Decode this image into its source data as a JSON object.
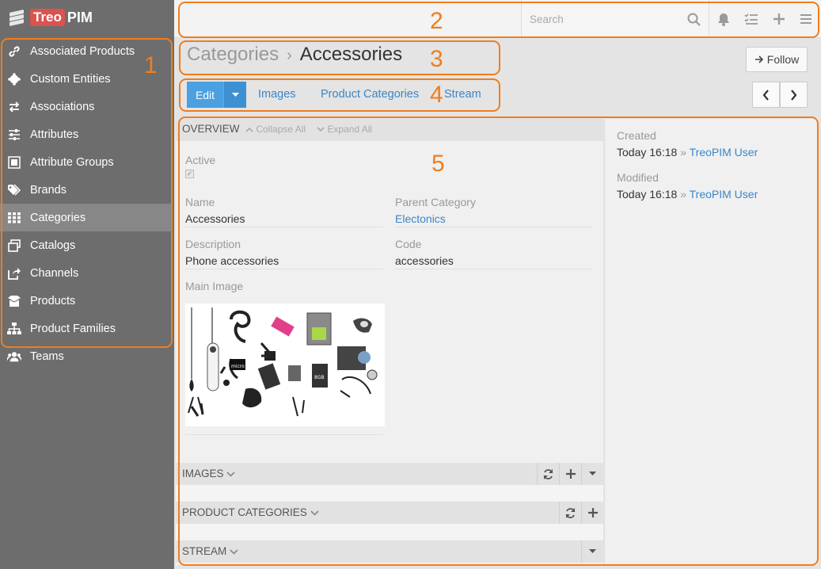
{
  "logo": {
    "part1": "Treo",
    "part2": "PIM"
  },
  "sidebar": {
    "items": [
      {
        "label": "Associated Products",
        "icon": "link-icon"
      },
      {
        "label": "Custom Entities",
        "icon": "puzzle-icon"
      },
      {
        "label": "Associations",
        "icon": "arrows-icon"
      },
      {
        "label": "Attributes",
        "icon": "sliders-icon"
      },
      {
        "label": "Attribute Groups",
        "icon": "group-icon"
      },
      {
        "label": "Brands",
        "icon": "tags-icon"
      },
      {
        "label": "Categories",
        "icon": "grid-icon",
        "active": true
      },
      {
        "label": "Catalogs",
        "icon": "stack-icon"
      },
      {
        "label": "Channels",
        "icon": "share-icon"
      },
      {
        "label": "Products",
        "icon": "box-icon"
      },
      {
        "label": "Product Families",
        "icon": "sitemap-icon"
      },
      {
        "label": "Teams",
        "icon": "users-icon"
      }
    ]
  },
  "header": {
    "search_placeholder": "Search"
  },
  "breadcrumb": {
    "parent": "Categories",
    "separator": "›",
    "current": "Accessories"
  },
  "follow_label": "Follow",
  "tabs": {
    "edit": "Edit",
    "items": [
      "Images",
      "Product Categories",
      "Stream"
    ]
  },
  "overview": {
    "title": "OVERVIEW",
    "collapse_all": "Collapse All",
    "expand_all": "Expand All",
    "fields": {
      "active_label": "Active",
      "active_checked": true,
      "name_label": "Name",
      "name_value": "Accessories",
      "parent_label": "Parent Category",
      "parent_value": "Electonics",
      "description_label": "Description",
      "description_value": "Phone accessories",
      "code_label": "Code",
      "code_value": "accessories",
      "main_image_label": "Main Image"
    }
  },
  "panels": [
    {
      "title": "IMAGES"
    },
    {
      "title": "PRODUCT CATEGORIES"
    },
    {
      "title": "STREAM"
    }
  ],
  "side": {
    "created_label": "Created",
    "created_time": "Today 16:18",
    "created_user": "TreoPIM User",
    "modified_label": "Modified",
    "modified_time": "Today 16:18",
    "modified_user": "TreoPIM User"
  },
  "annotations": [
    "1",
    "2",
    "3",
    "4",
    "5"
  ],
  "colors": {
    "accent": "#f07d1e",
    "primary": "#4aa0e0",
    "link": "#3a86c8",
    "sidebar": "#6d6d6d"
  }
}
